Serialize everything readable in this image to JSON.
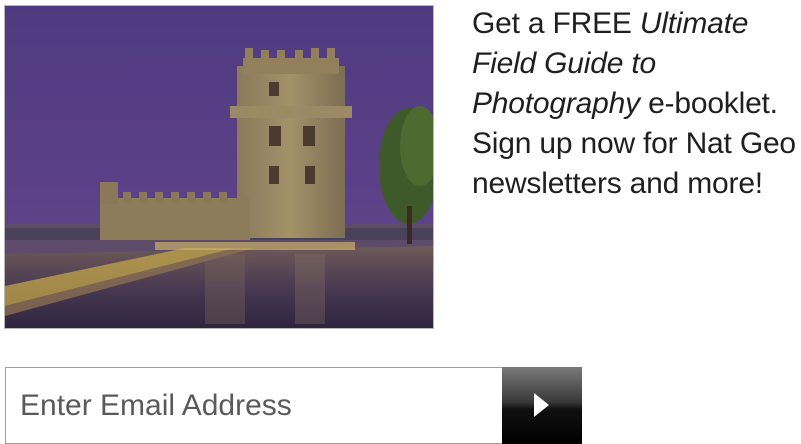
{
  "promo": {
    "lead": "Get a FREE ",
    "title": "Ultimate Field Guide to Photography",
    "tail": " e-booklet. Sign up now for Nat Geo newsletters and more!"
  },
  "photo": {
    "subject": "Belem Tower at dusk with wet reflective walkway"
  },
  "signup": {
    "email_placeholder": "Enter Email Address",
    "email_value": "",
    "submit_icon": "play-arrow-icon"
  },
  "colors": {
    "sky": "#5a3f87",
    "stone": "#8f7f5e",
    "button": "#1a1a1a",
    "text": "#1f1f1f"
  }
}
